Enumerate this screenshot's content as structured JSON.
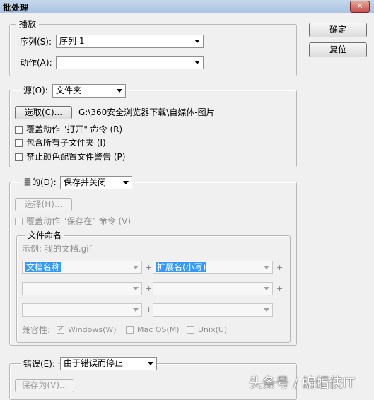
{
  "window": {
    "title": "批处理",
    "close_glyph": "✕"
  },
  "buttons": {
    "ok": "确定",
    "reset": "复位"
  },
  "play": {
    "legend": "播放",
    "set_label": "序列(S):",
    "set_value": "序列 1",
    "action_label": "动作(A):",
    "action_value": ""
  },
  "source": {
    "label": "源(O):",
    "value": "文件夹",
    "choose_label": "选取(C)...",
    "path": "G:\\360安全浏览器下载\\自媒体-图片",
    "options": [
      "覆盖动作 \"打开\" 命令 (R)",
      "包含所有子文件夹 (I)",
      "禁止颜色配置文件警告 (P)"
    ]
  },
  "destination": {
    "label": "目的(D):",
    "value": "保存并关闭",
    "choose_label": "选择(H)...",
    "override_label": "覆盖动作 \"保存在\" 命令 (V)",
    "file_naming": {
      "legend": "文件命名",
      "example": "示例: 我的文档.gif",
      "field1": "文档名称",
      "field2": "扩展名(小写)",
      "compat_label": "兼容性:",
      "compat": [
        "Windows(W)",
        "Mac OS(M)",
        "Unix(U)"
      ]
    }
  },
  "errors": {
    "label": "错误(E):",
    "value": "由于错误而停止",
    "save_as_label": "保存为(V)..."
  },
  "watermark": "头条号 / 蝙蝠侠IT"
}
